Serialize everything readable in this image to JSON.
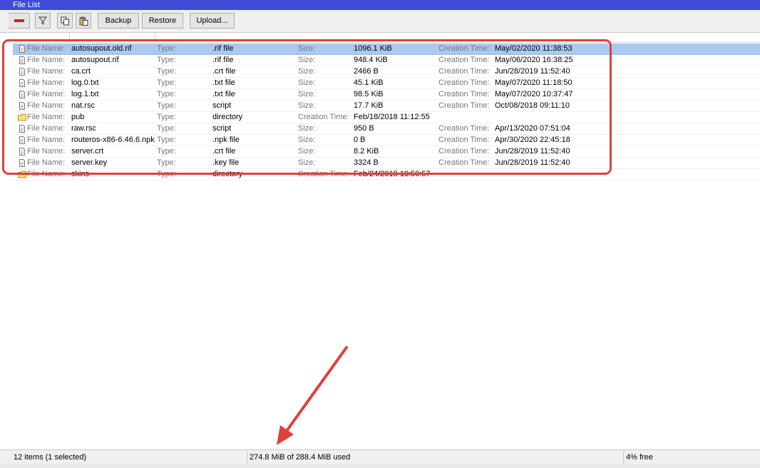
{
  "window": {
    "title": "File List"
  },
  "toolbar": {
    "remove_icon": "minus-icon",
    "filter_icon": "filter-icon",
    "copy_icon": "copy-icon",
    "paste_icon": "paste-icon",
    "backup_label": "Backup",
    "restore_label": "Restore",
    "upload_label": "Upload..."
  },
  "labels": {
    "file_name": "File Name:",
    "type": "Type:",
    "size": "Size:",
    "creation_time": "Creation Time:"
  },
  "files": [
    {
      "name": "autosupout.old.rif",
      "type": ".rif file",
      "size": "1096.1 KiB",
      "created": "May/02/2020 11:38:53",
      "is_dir": false,
      "selected": true
    },
    {
      "name": "autosupout.rif",
      "type": ".rif file",
      "size": "948.4 KiB",
      "created": "May/06/2020 16:38:25",
      "is_dir": false,
      "selected": false
    },
    {
      "name": "ca.crt",
      "type": ".crt file",
      "size": "2466 B",
      "created": "Jun/28/2019 11:52:40",
      "is_dir": false,
      "selected": false
    },
    {
      "name": "log.0.txt",
      "type": ".txt file",
      "size": "45.1 KiB",
      "created": "May/07/2020 11:18:50",
      "is_dir": false,
      "selected": false
    },
    {
      "name": "log.1.txt",
      "type": ".txt file",
      "size": "98.5 KiB",
      "created": "May/07/2020 10:37:47",
      "is_dir": false,
      "selected": false
    },
    {
      "name": "nat.rsc",
      "type": "script",
      "size": "17.7 KiB",
      "created": "Oct/08/2018 09:11:10",
      "is_dir": false,
      "selected": false
    },
    {
      "name": "pub",
      "type": "directory",
      "size": "",
      "created": "Feb/18/2018 11:12:55",
      "is_dir": true,
      "selected": false
    },
    {
      "name": "raw.rsc",
      "type": "script",
      "size": "950 B",
      "created": "Apr/13/2020 07:51:04",
      "is_dir": false,
      "selected": false
    },
    {
      "name": "routeros-x86-6.46.6.npk",
      "type": ".npk file",
      "size": "0 B",
      "created": "Apr/30/2020 22:45:18",
      "is_dir": false,
      "selected": false
    },
    {
      "name": "server.crt",
      "type": ".crt file",
      "size": "8.2 KiB",
      "created": "Jun/28/2019 11:52:40",
      "is_dir": false,
      "selected": false
    },
    {
      "name": "server.key",
      "type": ".key file",
      "size": "3324 B",
      "created": "Jun/28/2019 11:52:40",
      "is_dir": false,
      "selected": false
    },
    {
      "name": "skins",
      "type": "directory",
      "size": "",
      "created": "Feb/24/2018 18:50:57",
      "is_dir": true,
      "selected": false
    }
  ],
  "status": {
    "items": "12 items (1 selected)",
    "usage": "274.8 MiB of 288.4 MiB used",
    "free": "4% free"
  },
  "colors": {
    "titlebar": "#3f4bd8",
    "selection": "#a9c9ee",
    "annotation": "#e0403a"
  }
}
